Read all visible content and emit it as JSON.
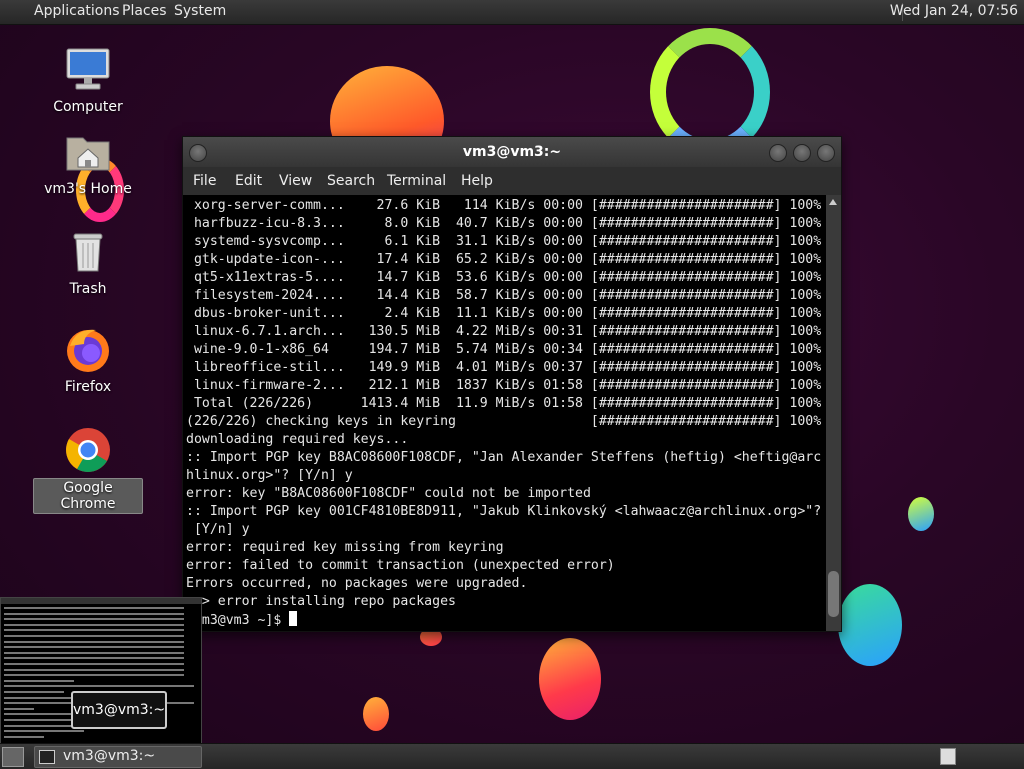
{
  "top_panel": {
    "menus": [
      "Applications",
      "Places",
      "System"
    ],
    "clock": "Wed Jan 24, 07:56"
  },
  "desktop_icons": [
    {
      "label": "Computer",
      "icon": "computer-icon"
    },
    {
      "label": "vm3's Home",
      "icon": "home-folder-icon"
    },
    {
      "label": "Trash",
      "icon": "trash-icon"
    },
    {
      "label": "Firefox",
      "icon": "firefox-icon"
    },
    {
      "label": "Google Chrome",
      "icon": "chrome-icon"
    }
  ],
  "window": {
    "title": "vm3@vm3:~",
    "menu": [
      "File",
      "Edit",
      "View",
      "Search",
      "Terminal",
      "Help"
    ]
  },
  "terminal": {
    "lines": [
      " xorg-server-comm...    27.6 KiB   114 KiB/s 00:00 [######################] 100%",
      " harfbuzz-icu-8.3...     8.0 KiB  40.7 KiB/s 00:00 [######################] 100%",
      " systemd-sysvcomp...     6.1 KiB  31.1 KiB/s 00:00 [######################] 100%",
      " gtk-update-icon-...    17.4 KiB  65.2 KiB/s 00:00 [######################] 100%",
      " qt5-x11extras-5....    14.7 KiB  53.6 KiB/s 00:00 [######################] 100%",
      " filesystem-2024....    14.4 KiB  58.7 KiB/s 00:00 [######################] 100%",
      " dbus-broker-unit...     2.4 KiB  11.1 KiB/s 00:00 [######################] 100%",
      " linux-6.7.1.arch...   130.5 MiB  4.22 MiB/s 00:31 [######################] 100%",
      " wine-9.0-1-x86_64     194.7 MiB  5.74 MiB/s 00:34 [######################] 100%",
      " libreoffice-stil...   149.9 MiB  4.01 MiB/s 00:37 [######################] 100%",
      " linux-firmware-2...   212.1 MiB  1837 KiB/s 01:58 [######################] 100%",
      " Total (226/226)      1413.4 MiB  11.9 MiB/s 01:58 [######################] 100%",
      "(226/226) checking keys in keyring                 [######################] 100%",
      "downloading required keys...",
      ":: Import PGP key B8AC08600F108CDF, \"Jan Alexander Steffens (heftig) <heftig@arc",
      "hlinux.org>\"? [Y/n] y",
      "error: key \"B8AC08600F108CDF\" could not be imported",
      ":: Import PGP key 001CF4810BE8D911, \"Jakub Klinkovský <lahwaacz@archlinux.org>\"?",
      " [Y/n] y",
      "error: required key missing from keyring",
      "error: failed to commit transaction (unexpected error)",
      "Errors occurred, no packages were upgraded.",
      " -> error installing repo packages"
    ],
    "prompt": "[vm3@vm3 ~]$ "
  },
  "workspace_preview": {
    "popup_label": "vm3@vm3:~"
  },
  "taskbar": {
    "task_label": "vm3@vm3:~"
  },
  "colors": {
    "desktop_bg": "#2a0626",
    "panel_bg": "#2e2e2e",
    "terminal_bg": "#000000",
    "terminal_fg": "#e6e6e6"
  }
}
